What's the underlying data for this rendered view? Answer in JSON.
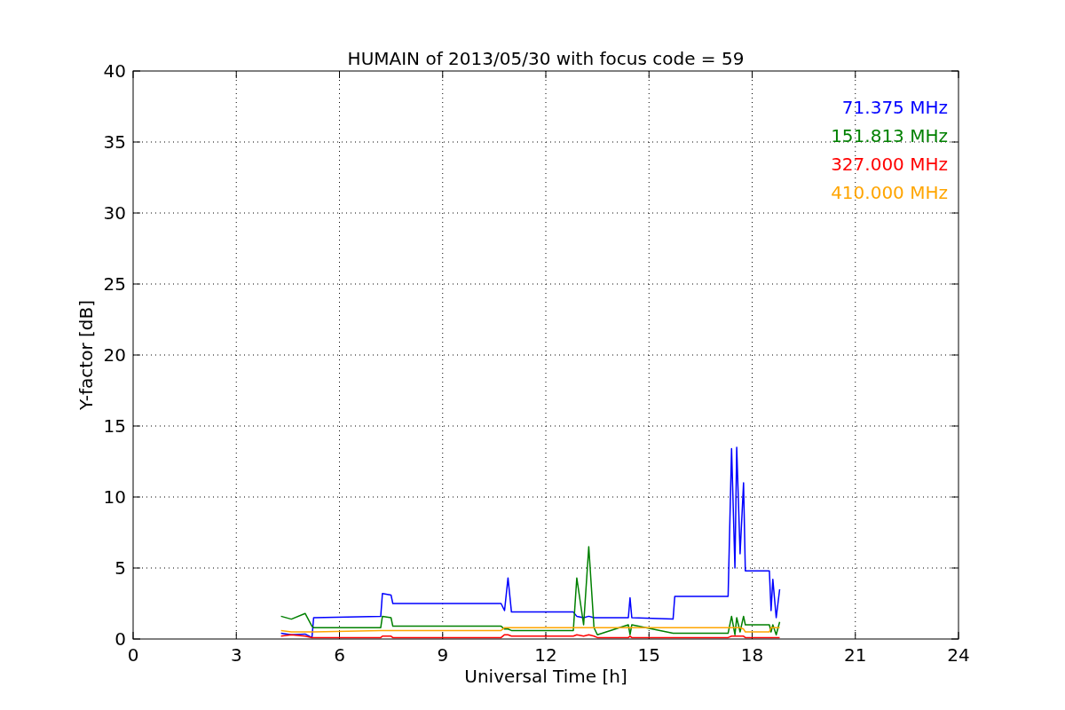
{
  "chart_data": {
    "type": "line",
    "title": "HUMAIN of 2013/05/30 with focus code = 59",
    "xlabel": "Universal Time [h]",
    "ylabel": "Y-factor [dB]",
    "xlim": [
      0,
      24
    ],
    "ylim": [
      0,
      40
    ],
    "xticks": [
      0,
      3,
      6,
      9,
      12,
      15,
      18,
      21,
      24
    ],
    "yticks": [
      0,
      5,
      10,
      15,
      20,
      25,
      30,
      35,
      40
    ],
    "grid": true,
    "x": [
      4.3,
      4.6,
      5.0,
      5.2,
      5.25,
      7.2,
      7.25,
      7.5,
      7.55,
      10.7,
      10.8,
      10.9,
      11.0,
      12.8,
      12.9,
      13.1,
      13.25,
      13.4,
      13.5,
      14.4,
      14.45,
      14.5,
      15.7,
      15.75,
      17.3,
      17.4,
      17.5,
      17.55,
      17.65,
      17.75,
      17.8,
      18.5,
      18.55,
      18.6,
      18.7,
      18.8
    ],
    "series": [
      {
        "name": "71.375 MHz",
        "color": "#0000ff",
        "values": [
          0.4,
          0.3,
          0.35,
          0.1,
          1.5,
          1.6,
          3.2,
          3.1,
          2.5,
          2.5,
          2.0,
          4.3,
          1.9,
          1.9,
          1.6,
          1.5,
          1.6,
          1.5,
          1.5,
          1.5,
          2.9,
          1.5,
          1.4,
          3.0,
          3.0,
          13.4,
          5.0,
          13.5,
          6.0,
          11.0,
          4.8,
          4.8,
          2.0,
          4.2,
          1.5,
          3.5
        ]
      },
      {
        "name": "151.813 MHz",
        "color": "#008000",
        "values": [
          1.6,
          1.4,
          1.8,
          0.9,
          0.8,
          0.8,
          1.6,
          1.5,
          0.9,
          0.9,
          0.7,
          0.7,
          0.6,
          0.6,
          4.3,
          1.0,
          6.5,
          0.8,
          0.3,
          1.0,
          0.3,
          1.0,
          0.4,
          0.4,
          0.4,
          1.6,
          0.3,
          1.5,
          0.5,
          1.6,
          1.0,
          1.0,
          0.5,
          1.0,
          0.3,
          1.2
        ]
      },
      {
        "name": "327.000 MHz",
        "color": "#ff0000",
        "values": [
          0.2,
          0.3,
          0.2,
          0.1,
          0.1,
          0.1,
          0.2,
          0.2,
          0.1,
          0.1,
          0.3,
          0.3,
          0.2,
          0.2,
          0.3,
          0.2,
          0.3,
          0.2,
          0.1,
          0.1,
          0.2,
          0.1,
          0.1,
          0.1,
          0.1,
          0.2,
          0.2,
          0.2,
          0.2,
          0.2,
          0.1,
          0.1,
          0.1,
          0.1,
          0.1,
          0.1
        ]
      },
      {
        "name": "410.000 MHz",
        "color": "#ffa500",
        "values": [
          0.6,
          0.5,
          0.5,
          0.5,
          0.5,
          0.6,
          0.6,
          0.6,
          0.6,
          0.6,
          0.8,
          0.8,
          0.8,
          0.8,
          0.8,
          0.8,
          0.8,
          0.8,
          0.8,
          0.8,
          0.8,
          0.8,
          0.8,
          0.8,
          0.8,
          0.8,
          0.8,
          0.8,
          0.8,
          0.7,
          0.5,
          0.5,
          0.8,
          0.8,
          0.8,
          0.8
        ]
      }
    ]
  }
}
